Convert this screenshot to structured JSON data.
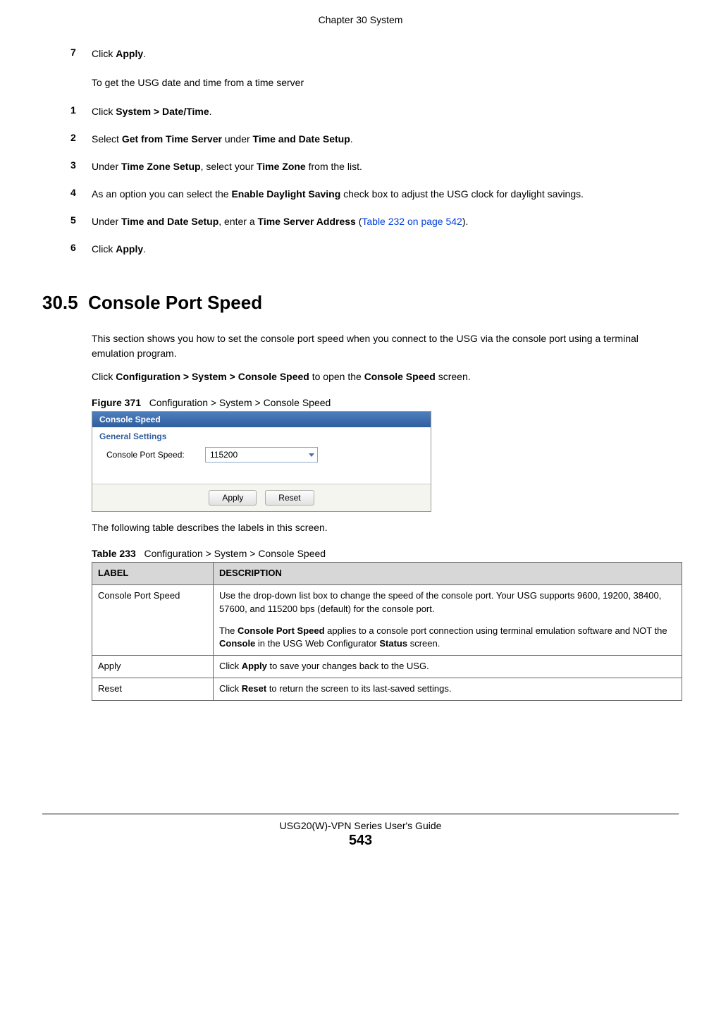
{
  "header": {
    "chapter": "Chapter 30 System"
  },
  "intro_steps": [
    {
      "num": "7",
      "pre": "Click ",
      "bold1": "Apply",
      "post": "."
    }
  ],
  "intro_sub": "To get the USG date and time from a time server",
  "time_steps": {
    "s1": {
      "num": "1",
      "pre": "Click ",
      "b1": "System > Date/Time",
      "post": "."
    },
    "s2": {
      "num": "2",
      "pre": "Select ",
      "b1": "Get from Time Server",
      "mid": " under ",
      "b2": "Time and Date Setup",
      "post": "."
    },
    "s3": {
      "num": "3",
      "pre": "Under ",
      "b1": "Time Zone Setup",
      "mid": ", select your ",
      "b2": "Time Zone",
      "post": " from the list."
    },
    "s4": {
      "num": "4",
      "pre": "As an option you can select the ",
      "b1": "Enable Daylight Saving",
      "post": " check box to adjust the USG clock for daylight savings."
    },
    "s5": {
      "num": "5",
      "pre": "Under ",
      "b1": "Time and Date Setup",
      "mid": ", enter a ",
      "b2": "Time Server Address",
      "post_pre": " (",
      "link": "Table 232 on page 542",
      "post": ")."
    },
    "s6": {
      "num": "6",
      "pre": "Click ",
      "b1": "Apply",
      "post": "."
    }
  },
  "section": {
    "number": "30.5",
    "title": "Console Port Speed"
  },
  "section_body": {
    "p1": "This section shows you how to set the console port speed when you connect to the USG via the console port using a terminal emulation program.",
    "p2_pre": "Click ",
    "p2_b1": "Configuration > System > Console Speed",
    "p2_mid": " to open the ",
    "p2_b2": "Console Speed",
    "p2_post": " screen."
  },
  "figure": {
    "label": "Figure 371",
    "caption": "Configuration > System > Console Speed",
    "panel_title": "Console Speed",
    "section_label": "General Settings",
    "field_label": "Console Port Speed:",
    "field_value": "115200",
    "btn_apply": "Apply",
    "btn_reset": "Reset"
  },
  "after_figure": "The following table describes the labels in this screen.",
  "table": {
    "label": "Table 233",
    "caption": "Configuration > System > Console Speed",
    "head_label": "LABEL",
    "head_desc": "DESCRIPTION",
    "rows": {
      "r1": {
        "label": "Console Port Speed",
        "d1": "Use the drop-down list box to change the speed of the console port. Your USG supports 9600, 19200, 38400, 57600, and 115200 bps (default) for the console port.",
        "d2_pre": "The ",
        "d2_b1": "Console Port Speed",
        "d2_mid1": " applies to a console port connection using terminal emulation software and NOT the ",
        "d2_b2": "Console",
        "d2_mid2": " in the USG Web Configurator ",
        "d2_b3": "Status",
        "d2_post": " screen."
      },
      "r2": {
        "label": "Apply",
        "d_pre": "Click ",
        "d_b": "Apply",
        "d_post": " to save your changes back to the USG."
      },
      "r3": {
        "label": "Reset",
        "d_pre": "Click ",
        "d_b": "Reset",
        "d_post": " to return the screen to its last-saved settings."
      }
    }
  },
  "footer": {
    "guide": "USG20(W)-VPN Series User's Guide",
    "page": "543"
  }
}
